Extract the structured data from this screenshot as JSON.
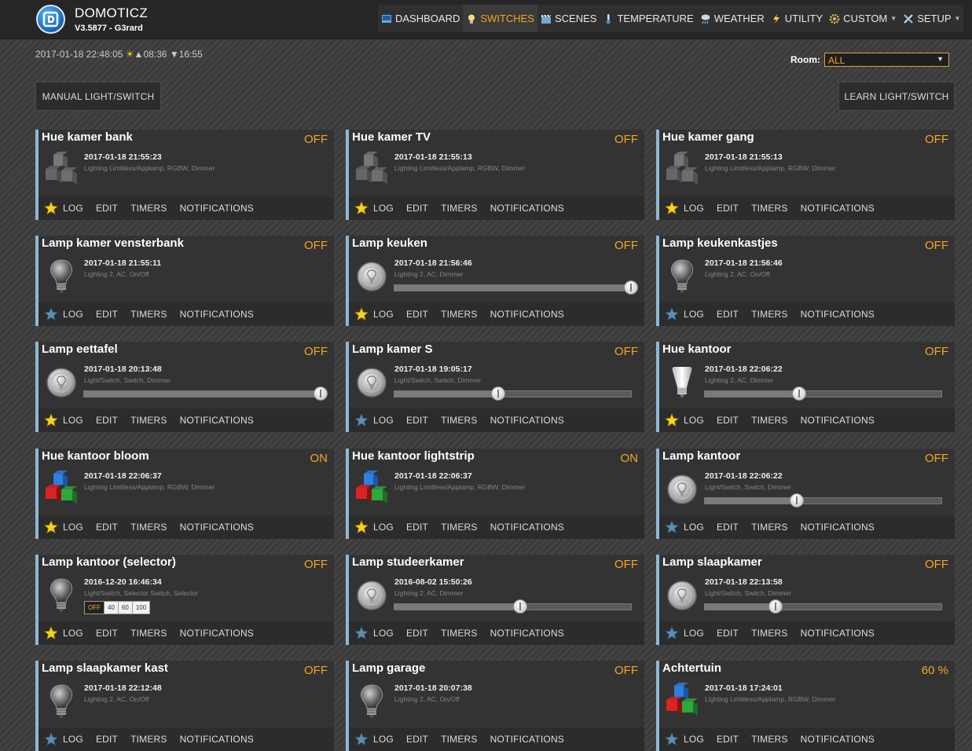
{
  "app": {
    "title": "DOMOTICZ",
    "version": "V3.5877 - G3rard"
  },
  "nav": [
    {
      "label": "DASHBOARD",
      "icon": "dashboard-icon",
      "active": false,
      "caret": false
    },
    {
      "label": "SWITCHES",
      "icon": "lightbulb-icon",
      "active": true,
      "caret": false
    },
    {
      "label": "SCENES",
      "icon": "clapperboard-icon",
      "active": false,
      "caret": false
    },
    {
      "label": "TEMPERATURE",
      "icon": "thermometer-icon",
      "active": false,
      "caret": false
    },
    {
      "label": "WEATHER",
      "icon": "cloud-rain-icon",
      "active": false,
      "caret": false
    },
    {
      "label": "UTILITY",
      "icon": "lightning-icon",
      "active": false,
      "caret": false
    },
    {
      "label": "CUSTOM",
      "icon": "gear-icon",
      "active": false,
      "caret": true
    },
    {
      "label": "SETUP",
      "icon": "tools-icon",
      "active": false,
      "caret": true
    }
  ],
  "status": {
    "datetime": "2017-01-18 22:48:05",
    "sunrise": "08:36",
    "sunset": "16:55"
  },
  "room": {
    "label": "Room:",
    "value": "ALL"
  },
  "buttons": {
    "manual": "MANUAL LIGHT/SWITCH",
    "learn": "LEARN LIGHT/SWITCH"
  },
  "actions": {
    "log": "LOG",
    "edit": "EDIT",
    "timers": "TIMERS",
    "notifications": "NOTIFICATIONS"
  },
  "colors": {
    "accent": "#f5a623",
    "card_bg": "#333333",
    "card_border": "#8fb8d6"
  },
  "devices": [
    {
      "name": "Hue kamer bank",
      "status": "OFF",
      "date": "2017-01-18 21:55:23",
      "type": "Lighting Limitless/Applamp, RGBW, Dimmer",
      "icon": "rgb-cubes-off-icon",
      "control": "none",
      "favorite": true
    },
    {
      "name": "Hue kamer TV",
      "status": "OFF",
      "date": "2017-01-18 21:55:13",
      "type": "Lighting Limitless/Applamp, RGBW, Dimmer",
      "icon": "rgb-cubes-off-icon",
      "control": "none",
      "favorite": true
    },
    {
      "name": "Hue kamer gang",
      "status": "OFF",
      "date": "2017-01-18 21:55:13",
      "type": "Lighting Limitless/Applamp, RGBW, Dimmer",
      "icon": "rgb-cubes-off-icon",
      "control": "none",
      "favorite": true
    },
    {
      "name": "Lamp kamer vensterbank",
      "status": "OFF",
      "date": "2017-01-18 21:55:11",
      "type": "Lighting 2, AC, On/Off",
      "icon": "bulb-off-icon",
      "control": "none",
      "favorite": false
    },
    {
      "name": "Lamp keuken",
      "status": "OFF",
      "date": "2017-01-18 21:56:46",
      "type": "Lighting 2, AC, Dimmer",
      "icon": "dimmer-off-icon",
      "control": "slider",
      "level": 1.0,
      "favorite": true
    },
    {
      "name": "Lamp keukenkastjes",
      "status": "OFF",
      "date": "2017-01-18 21:56:46",
      "type": "Lighting 2, AC, On/Off",
      "icon": "bulb-off-icon",
      "control": "none",
      "favorite": false
    },
    {
      "name": "Lamp eettafel",
      "status": "OFF",
      "date": "2017-01-18 20:13:48",
      "type": "Light/Switch, Switch, Dimmer",
      "icon": "dimmer-off-icon",
      "control": "slider",
      "level": 1.0,
      "favorite": true
    },
    {
      "name": "Lamp kamer S",
      "status": "OFF",
      "date": "2017-01-18 19:05:17",
      "type": "Light/Switch, Switch, Dimmer",
      "icon": "dimmer-off-icon",
      "control": "slider",
      "level": 0.44,
      "favorite": false
    },
    {
      "name": "Hue kantoor",
      "status": "OFF",
      "date": "2017-01-18 22:06:22",
      "type": "Lighting 2, AC, Dimmer",
      "icon": "hue-bulb-icon",
      "control": "slider",
      "level": 0.4,
      "favorite": true
    },
    {
      "name": "Hue kantoor bloom",
      "status": "ON",
      "date": "2017-01-18 22:06:37",
      "type": "Lighting Limitless/Applamp, RGBW, Dimmer",
      "icon": "rgb-cubes-on-icon",
      "control": "none",
      "favorite": true
    },
    {
      "name": "Hue kantoor lightstrip",
      "status": "ON",
      "date": "2017-01-18 22:06:37",
      "type": "Lighting Limitless/Applamp, RGBW, Dimmer",
      "icon": "rgb-cubes-on-icon",
      "control": "none",
      "favorite": true
    },
    {
      "name": "Lamp kantoor",
      "status": "OFF",
      "date": "2017-01-18 22:06:22",
      "type": "Light/Switch, Switch, Dimmer",
      "icon": "dimmer-off-icon",
      "control": "slider",
      "level": 0.39,
      "favorite": false
    },
    {
      "name": "Lamp kantoor (selector)",
      "status": "OFF",
      "date": "2016-12-20 16:46:34",
      "type": "Light/Switch, Selector Switch, Selector",
      "icon": "bulb-off-icon",
      "control": "selector",
      "options": [
        "OFF",
        "40",
        "60",
        "100"
      ],
      "selected": 0,
      "favorite": true
    },
    {
      "name": "Lamp studeerkamer",
      "status": "OFF",
      "date": "2016-08-02 15:50:26",
      "type": "Lighting 2, AC, Dimmer",
      "icon": "dimmer-off-icon",
      "control": "slider",
      "level": 0.53,
      "favorite": false
    },
    {
      "name": "Lamp slaapkamer",
      "status": "OFF",
      "date": "2017-01-18 22:13:58",
      "type": "Light/Switch, Switch, Dimmer",
      "icon": "dimmer-off-icon",
      "control": "slider",
      "level": 0.3,
      "favorite": false
    },
    {
      "name": "Lamp slaapkamer kast",
      "status": "OFF",
      "date": "2017-01-18 22:12:48",
      "type": "Lighting 2, AC, On/Off",
      "icon": "bulb-off-icon",
      "control": "none",
      "favorite": false
    },
    {
      "name": "Lamp garage",
      "status": "OFF",
      "date": "2017-01-18 20:07:38",
      "type": "Lighting 2, AC, On/Off",
      "icon": "bulb-off-icon",
      "control": "none",
      "favorite": false
    },
    {
      "name": "Achtertuin",
      "status": "60 %",
      "date": "2017-01-18 17:24:01",
      "type": "Lighting Limitless/Applamp, RGBW, Dimmer",
      "icon": "rgb-cubes-on-icon",
      "control": "none",
      "favorite": false
    }
  ]
}
